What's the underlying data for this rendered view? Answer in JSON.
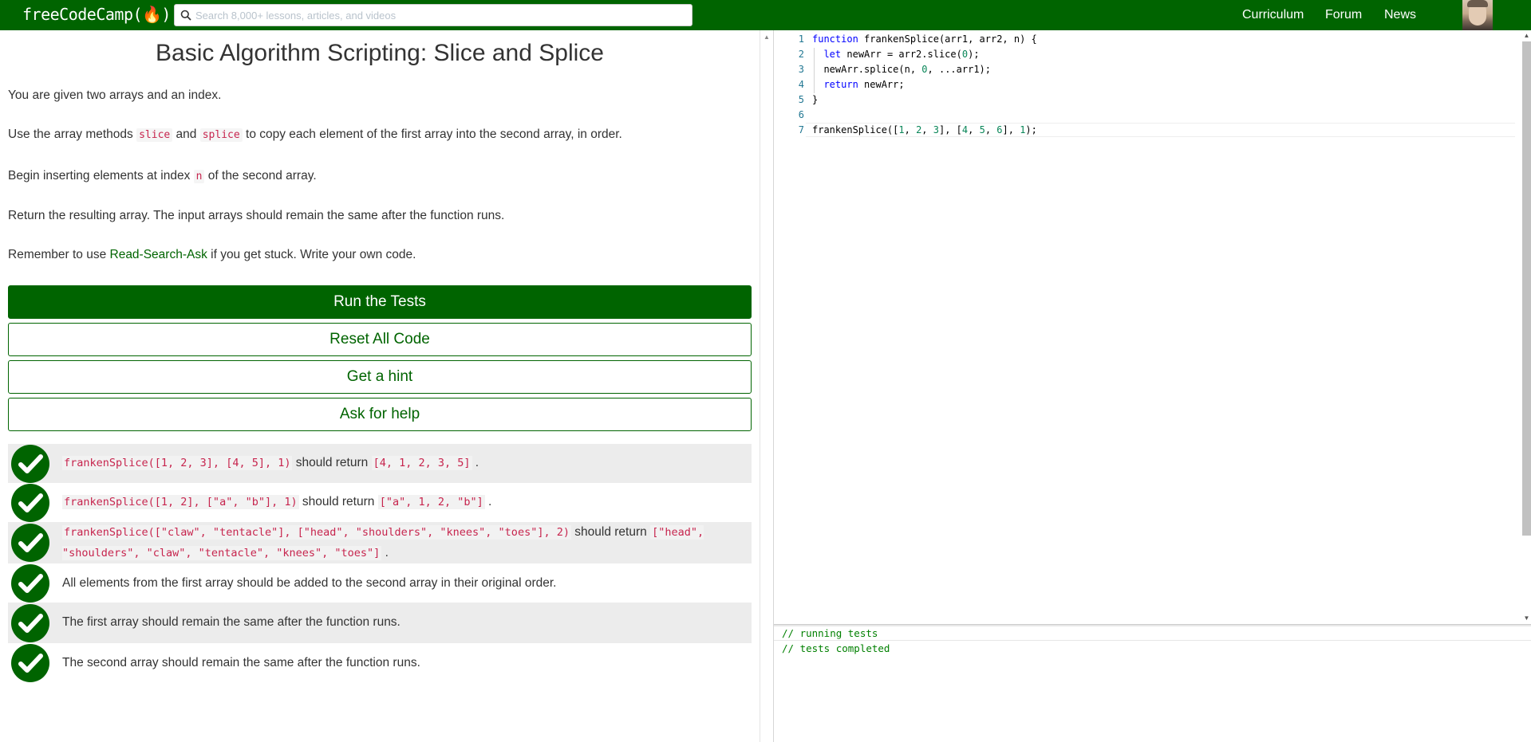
{
  "nav": {
    "logo": "freeCodeCamp(🔥)",
    "search_placeholder": "Search 8,000+ lessons, articles, and videos",
    "links": [
      "Curriculum",
      "Forum",
      "News"
    ]
  },
  "challenge": {
    "title": "Basic Algorithm Scripting: Slice and Splice",
    "p1": "You are given two arrays and an index.",
    "p2_before": "Use the array methods ",
    "p2_code1": "slice",
    "p2_mid": " and ",
    "p2_code2": "splice",
    "p2_after": " to copy each element of the first array into the second array, in order.",
    "p3_before": "Begin inserting elements at index ",
    "p3_code": "n",
    "p3_after": " of the second array.",
    "p4": "Return the resulting array. The input arrays should remain the same after the function runs.",
    "p5_before": "Remember to use ",
    "p5_link": "Read-Search-Ask",
    "p5_after": " if you get stuck. Write your own code."
  },
  "buttons": {
    "run": "Run the Tests",
    "reset": "Reset All Code",
    "hint": "Get a hint",
    "help": "Ask for help"
  },
  "tests": {
    "t1_code1": "frankenSplice([1, 2, 3], [4, 5], 1)",
    "t1_mid": " should return ",
    "t1_code2": "[4, 1, 2, 3, 5]",
    "t1_end": " .",
    "t2_code1": "frankenSplice([1, 2], [\"a\", \"b\"], 1)",
    "t2_mid": " should return ",
    "t2_code2": "[\"a\", 1, 2, \"b\"]",
    "t2_end": " .",
    "t3_code1": "frankenSplice([\"claw\", \"tentacle\"], [\"head\", \"shoulders\", \"knees\", \"toes\"], 2)",
    "t3_mid": " should return ",
    "t3_code2": "[\"head\", \"shoulders\", \"claw\", \"tentacle\", \"knees\", \"toes\"]",
    "t3_end": " .",
    "t4": "All elements from the first array should be added to the second array in their original order.",
    "t5": "The first array should remain the same after the function runs.",
    "t6": "The second array should remain the same after the function runs."
  },
  "editor": {
    "line_numbers": [
      "1",
      "2",
      "3",
      "4",
      "5",
      "6",
      "7"
    ],
    "l1_kw": "function",
    "l1_rest": " frankenSplice(arr1, arr2, n) {",
    "l2_indent": "  ",
    "l2_kw": "let",
    "l2_a": " newArr = arr2.slice(",
    "l2_n": "0",
    "l2_b": ");",
    "l3_a": "  newArr.splice(n, ",
    "l3_n": "0",
    "l3_b": ", ...arr1);",
    "l4_indent": "  ",
    "l4_kw": "return",
    "l4_rest": " newArr;",
    "l5": "}",
    "l7_a": "frankenSplice([",
    "l7_n1": "1",
    "l7_s1": ", ",
    "l7_n2": "2",
    "l7_s2": ", ",
    "l7_n3": "3",
    "l7_s3": "], [",
    "l7_n4": "4",
    "l7_s4": ", ",
    "l7_n5": "5",
    "l7_s5": ", ",
    "l7_n6": "6",
    "l7_s6": "], ",
    "l7_n7": "1",
    "l7_s7": ");"
  },
  "output": {
    "line1": "// running tests",
    "line2": "// tests completed"
  },
  "colors": {
    "brand": "#006400",
    "code_red": "#c7254e",
    "keyword": "#0000ff",
    "number": "#098658",
    "output_green": "#008000"
  }
}
